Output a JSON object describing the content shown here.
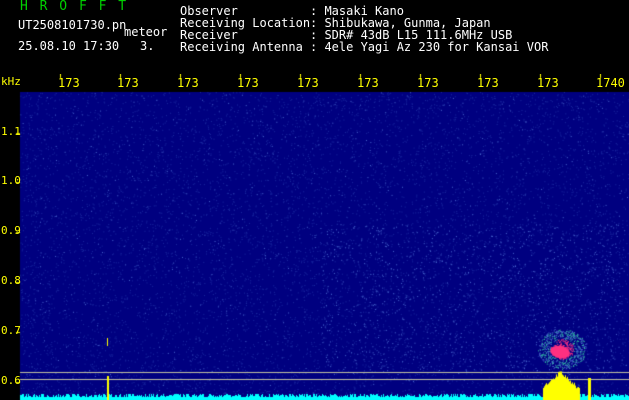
{
  "header": {
    "logo": "H R O F F T",
    "filename": "UT2508101730.pn",
    "mode": "meteor",
    "datetime": "25.08.10 17:30",
    "count": "3.",
    "meta": [
      {
        "key": "Observer",
        "value": ": Masaki Kano"
      },
      {
        "key": "Receiving Location",
        "value": ": Shibukawa, Gunma, Japan"
      },
      {
        "key": "Receiver",
        "value": ": SDR# 43dB L15 111.6MHz USB"
      },
      {
        "key": "Receiving Antenna",
        "value": ": 4ele Yagi Az 230 for Kansai VOR"
      }
    ]
  },
  "spectrogram": {
    "unit_label": "kHz",
    "time_ticks": [
      "173",
      "173",
      "173",
      "173",
      "173",
      "173",
      "173",
      "173",
      "173",
      "1740"
    ],
    "freq_ticks": [
      "1.1",
      "1.0",
      "0.9",
      "0.8",
      "0.7",
      "0.6"
    ],
    "colors": {
      "background": "#000080",
      "noise_low": "#1a2aa0",
      "noise_high": "#4a6ad0",
      "baseline": "#00ffff",
      "event": "#ffff00",
      "echo_core": "#ff3080",
      "echo_halo": "#30c0a0",
      "ticks": "#ffff00",
      "gridline": "#c0c0a0"
    }
  }
}
